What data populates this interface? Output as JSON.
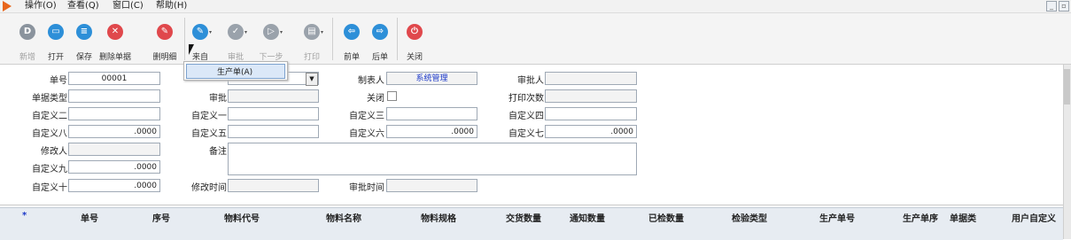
{
  "menubar": {
    "items": [
      "操作(O)",
      "查看(Q)",
      "窗口(C)",
      "帮助(H)"
    ],
    "window_buttons": [
      "_",
      "b"
    ]
  },
  "toolbar": {
    "buttons": [
      {
        "label": "新增",
        "icon": "new-doc-icon",
        "color": "#8a939d",
        "glyph": "D",
        "enabled": false
      },
      {
        "label": "打开",
        "icon": "folder-open-icon",
        "color": "#2d8fd8",
        "glyph": "▭",
        "enabled": true
      },
      {
        "label": "保存",
        "icon": "save-icon",
        "color": "#2d8fd8",
        "glyph": "≡",
        "enabled": true
      },
      {
        "label": "删除单据",
        "icon": "delete-doc-icon",
        "color": "#e0484c",
        "glyph": "✕",
        "enabled": true
      },
      {
        "label": "删明细",
        "icon": "delete-detail-icon",
        "color": "#e0484c",
        "glyph": "✎",
        "enabled": true
      },
      {
        "label": "来自",
        "icon": "source-from-icon",
        "color": "#2d8fd8",
        "glyph": "✎",
        "enabled": true
      },
      {
        "label": "审批",
        "icon": "approve-icon",
        "color": "#9aa2ab",
        "glyph": "✓",
        "enabled": false
      },
      {
        "label": "下一步",
        "icon": "next-step-icon",
        "color": "#9aa2ab",
        "glyph": "▷",
        "enabled": false
      },
      {
        "label": "打印",
        "icon": "print-icon",
        "color": "#9aa2ab",
        "glyph": "▤",
        "enabled": false
      },
      {
        "label": "前单",
        "icon": "previous-record-icon",
        "color": "#2d8fd8",
        "glyph": "⇦",
        "enabled": true
      },
      {
        "label": "后单",
        "icon": "next-record-icon",
        "color": "#2d8fd8",
        "glyph": "⇨",
        "enabled": true
      },
      {
        "label": "关闭",
        "icon": "close-icon",
        "color": "#e0484c",
        "glyph": "⏻",
        "enabled": true
      }
    ]
  },
  "dropdown": {
    "item": "生产单(A)"
  },
  "form": {
    "danhao_label": "单号",
    "danhao_value": "00001",
    "zhibiaoren_label": "制表人",
    "zhibiaoren_value": "系统管理",
    "shenpiren_label": "审批人",
    "danjuleixing_label": "单据类型",
    "shenpi_label": "审批",
    "guanbi_label": "关闭",
    "dayincishu_label": "打印次数",
    "zdy2_label": "自定义二",
    "zdy1_label": "自定义一",
    "zdy3_label": "自定义三",
    "zdy4_label": "自定义四",
    "zdy8_label": "自定义八",
    "zdy8_value": ".0000",
    "zdy5_label": "自定义五",
    "zdy6_label": "自定义六",
    "zdy6_value": ".0000",
    "zdy7_label": "自定义七",
    "zdy7_value": ".0000",
    "xiugairen_label": "修改人",
    "beizhu_label": "备注",
    "zdy9_label": "自定义九",
    "zdy9_value": ".0000",
    "zdy10_label": "自定义十",
    "zdy10_value": ".0000",
    "xiugaishijian_label": "修改时间",
    "shenpishijian_label": "审批时间"
  },
  "grid": {
    "columns": [
      "*",
      "单号",
      "序号",
      "物料代号",
      "物料名称",
      "物料规格",
      "交货数量",
      "通知数量",
      "已检数量",
      "检验类型",
      "生产单号",
      "生产单序",
      "单据类",
      "用户自定义"
    ]
  },
  "colors": {
    "accent_blue": "#2d8fd8",
    "danger_red": "#e0484c",
    "disabled_gray": "#9aa2ab",
    "link_blue": "#1a37c8"
  }
}
